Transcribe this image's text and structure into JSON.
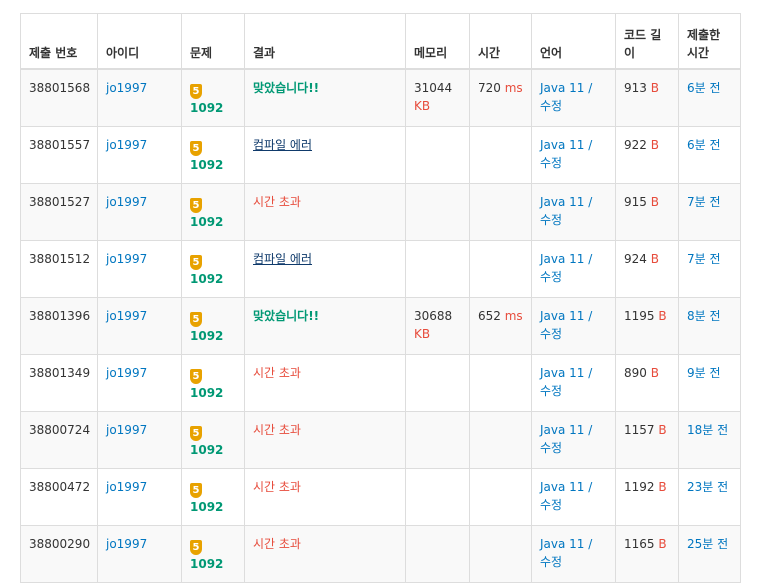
{
  "headers": {
    "id": "제출 번호",
    "user": "아이디",
    "problem": "문제",
    "result": "결과",
    "memory": "메모리",
    "time": "시간",
    "language": "언어",
    "code_length": "코드 길이",
    "submitted": "제출한 시간"
  },
  "colors": {
    "link": "#0076c0",
    "accepted": "#009874",
    "time_limit": "#e74c3c",
    "compile_error": "#0f3a6b",
    "tier_gold": "#e8a200"
  },
  "rows": [
    {
      "id": "38801568",
      "user": "jo1997",
      "tier": "5",
      "problem": "1092",
      "result": "맞았습니다!!",
      "result_type": "ac",
      "memory": "31044",
      "memory_unit": "KB",
      "time": "720",
      "time_unit": "ms",
      "lang": "Java 11",
      "lang_sep": "/",
      "lang_edit": "수정",
      "code_len": "913",
      "code_unit": "B",
      "submitted": "6분 전"
    },
    {
      "id": "38801557",
      "user": "jo1997",
      "tier": "5",
      "problem": "1092",
      "result": "컴파일 에러",
      "result_type": "ce",
      "memory": "",
      "memory_unit": "",
      "time": "",
      "time_unit": "",
      "lang": "Java 11",
      "lang_sep": "/",
      "lang_edit": "수정",
      "code_len": "922",
      "code_unit": "B",
      "submitted": "6분 전"
    },
    {
      "id": "38801527",
      "user": "jo1997",
      "tier": "5",
      "problem": "1092",
      "result": "시간 초과",
      "result_type": "tle",
      "memory": "",
      "memory_unit": "",
      "time": "",
      "time_unit": "",
      "lang": "Java 11",
      "lang_sep": "/",
      "lang_edit": "수정",
      "code_len": "915",
      "code_unit": "B",
      "submitted": "7분 전"
    },
    {
      "id": "38801512",
      "user": "jo1997",
      "tier": "5",
      "problem": "1092",
      "result": "컴파일 에러",
      "result_type": "ce",
      "memory": "",
      "memory_unit": "",
      "time": "",
      "time_unit": "",
      "lang": "Java 11",
      "lang_sep": "/",
      "lang_edit": "수정",
      "code_len": "924",
      "code_unit": "B",
      "submitted": "7분 전"
    },
    {
      "id": "38801396",
      "user": "jo1997",
      "tier": "5",
      "problem": "1092",
      "result": "맞았습니다!!",
      "result_type": "ac",
      "memory": "30688",
      "memory_unit": "KB",
      "time": "652",
      "time_unit": "ms",
      "lang": "Java 11",
      "lang_sep": "/",
      "lang_edit": "수정",
      "code_len": "1195",
      "code_unit": "B",
      "submitted": "8분 전"
    },
    {
      "id": "38801349",
      "user": "jo1997",
      "tier": "5",
      "problem": "1092",
      "result": "시간 초과",
      "result_type": "tle",
      "memory": "",
      "memory_unit": "",
      "time": "",
      "time_unit": "",
      "lang": "Java 11",
      "lang_sep": "/",
      "lang_edit": "수정",
      "code_len": "890",
      "code_unit": "B",
      "submitted": "9분 전"
    },
    {
      "id": "38800724",
      "user": "jo1997",
      "tier": "5",
      "problem": "1092",
      "result": "시간 초과",
      "result_type": "tle",
      "memory": "",
      "memory_unit": "",
      "time": "",
      "time_unit": "",
      "lang": "Java 11",
      "lang_sep": "/",
      "lang_edit": "수정",
      "code_len": "1157",
      "code_unit": "B",
      "submitted": "18분 전"
    },
    {
      "id": "38800472",
      "user": "jo1997",
      "tier": "5",
      "problem": "1092",
      "result": "시간 초과",
      "result_type": "tle",
      "memory": "",
      "memory_unit": "",
      "time": "",
      "time_unit": "",
      "lang": "Java 11",
      "lang_sep": "/",
      "lang_edit": "수정",
      "code_len": "1192",
      "code_unit": "B",
      "submitted": "23분 전"
    },
    {
      "id": "38800290",
      "user": "jo1997",
      "tier": "5",
      "problem": "1092",
      "result": "시간 초과",
      "result_type": "tle",
      "memory": "",
      "memory_unit": "",
      "time": "",
      "time_unit": "",
      "lang": "Java 11",
      "lang_sep": "/",
      "lang_edit": "수정",
      "code_len": "1165",
      "code_unit": "B",
      "submitted": "25분 전"
    }
  ]
}
